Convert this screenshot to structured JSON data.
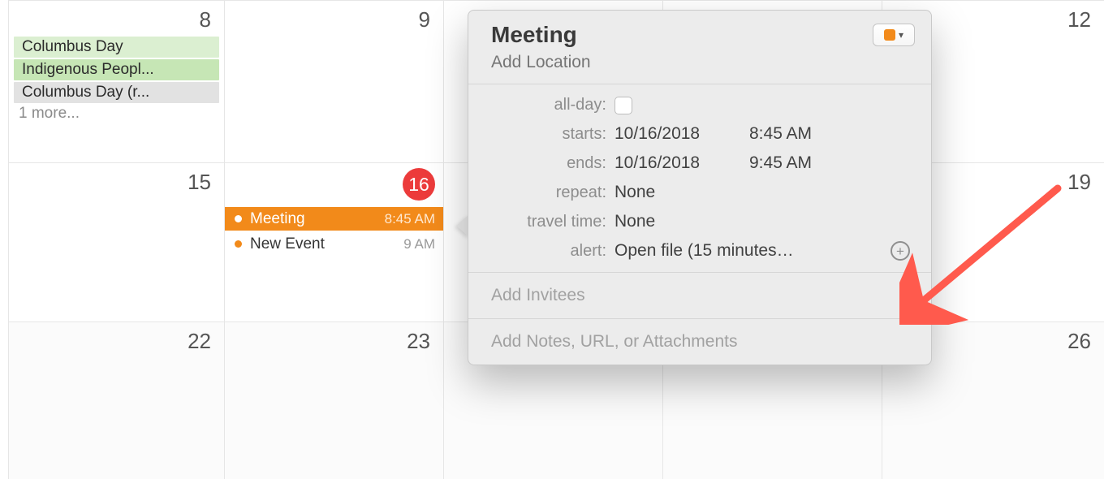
{
  "calendar": {
    "row1": {
      "d8": "8",
      "d9": "9",
      "d12": "12",
      "holidays": [
        {
          "label": "Columbus Day",
          "cls": "h-green"
        },
        {
          "label": "Indigenous Peopl...",
          "cls": "h-green2"
        },
        {
          "label": "Columbus Day (r...",
          "cls": "h-gray"
        }
      ],
      "more_label": "1 more..."
    },
    "row2": {
      "d15": "15",
      "d16_today": "16",
      "d19": "19",
      "events": [
        {
          "title": "Meeting",
          "time": "8:45 AM",
          "selected": true
        },
        {
          "title": "New Event",
          "time": "9 AM",
          "selected": false
        }
      ]
    },
    "row3": {
      "d22": "22",
      "d23": "23",
      "d26": "26"
    }
  },
  "popover": {
    "title": "Meeting",
    "location_placeholder": "Add Location",
    "labels": {
      "all_day": "all-day:",
      "starts": "starts:",
      "ends": "ends:",
      "repeat": "repeat:",
      "travel_time": "travel time:",
      "alert": "alert:"
    },
    "starts_date": "10/16/2018",
    "starts_time": "8:45 AM",
    "ends_date": "10/16/2018",
    "ends_time": "9:45 AM",
    "repeat_value": "None",
    "travel_value": "None",
    "alert_value": "Open file (15 minutes…",
    "invitees_placeholder": "Add Invitees",
    "notes_placeholder": "Add Notes, URL, or Attachments",
    "calendar_color": "#f28a1a"
  }
}
